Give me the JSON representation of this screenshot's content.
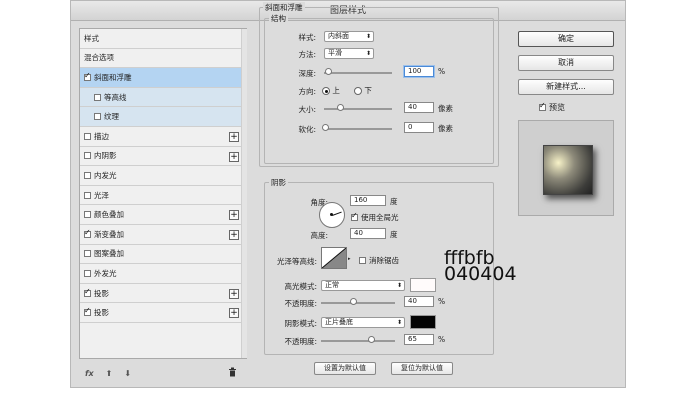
{
  "title": "图层样式",
  "sidebar": {
    "items": [
      {
        "label": "样式",
        "checkbox": false,
        "checked": false,
        "plus": false
      },
      {
        "label": "混合选项",
        "checkbox": false,
        "checked": false,
        "plus": false
      },
      {
        "label": "斜面和浮雕",
        "checkbox": true,
        "checked": true,
        "plus": false,
        "selected": true
      },
      {
        "label": "等高线",
        "checkbox": true,
        "checked": false,
        "plus": false,
        "sub": true
      },
      {
        "label": "纹理",
        "checkbox": true,
        "checked": false,
        "plus": false,
        "sub": true
      },
      {
        "label": "描边",
        "checkbox": true,
        "checked": false,
        "plus": true
      },
      {
        "label": "内阴影",
        "checkbox": true,
        "checked": false,
        "plus": true
      },
      {
        "label": "内发光",
        "checkbox": true,
        "checked": false,
        "plus": false
      },
      {
        "label": "光泽",
        "checkbox": true,
        "checked": false,
        "plus": false
      },
      {
        "label": "颜色叠加",
        "checkbox": true,
        "checked": false,
        "plus": true
      },
      {
        "label": "渐变叠加",
        "checkbox": true,
        "checked": true,
        "plus": true
      },
      {
        "label": "图案叠加",
        "checkbox": true,
        "checked": false,
        "plus": false
      },
      {
        "label": "外发光",
        "checkbox": true,
        "checked": false,
        "plus": false
      },
      {
        "label": "投影",
        "checkbox": true,
        "checked": true,
        "plus": true
      },
      {
        "label": "投影",
        "checkbox": true,
        "checked": true,
        "plus": true
      }
    ],
    "bottom": {
      "fx": "fx",
      "up": "⬆",
      "down": "⬇",
      "trash": "🗑"
    }
  },
  "bevel": {
    "section_title": "斜面和浮雕",
    "structure_title": "结构",
    "style_label": "样式:",
    "style_value": "内斜面",
    "technique_label": "方法:",
    "technique_value": "平滑",
    "depth_label": "深度:",
    "depth_value": "100",
    "depth_unit": "%",
    "direction_label": "方向:",
    "dir_up": "上",
    "dir_down": "下",
    "size_label": "大小:",
    "size_value": "40",
    "size_unit": "像素",
    "soften_label": "软化:",
    "soften_value": "0",
    "soften_unit": "像素"
  },
  "shading": {
    "title": "阴影",
    "angle_label": "角度:",
    "angle_value": "160",
    "angle_unit": "度",
    "global_light": "使用全局光",
    "altitude_label": "高度:",
    "altitude_value": "40",
    "altitude_unit": "度",
    "gloss_label": "光泽等高线:",
    "antialias": "消除锯齿",
    "highlight_mode_label": "高光模式:",
    "highlight_mode": "正常",
    "highlight_opacity_label": "不透明度:",
    "highlight_opacity": "40",
    "highlight_opacity_unit": "%",
    "shadow_mode_label": "阴影模式:",
    "shadow_mode": "正片叠底",
    "shadow_opacity_label": "不透明度:",
    "shadow_opacity": "65",
    "shadow_opacity_unit": "%",
    "highlight_color": "#fffbfb",
    "shadow_color": "#040404",
    "annotation_highlight": "fffbfb",
    "annotation_shadow": "040404"
  },
  "footer": {
    "set_default": "设置为默认值",
    "reset_default": "复位为默认值"
  },
  "actions": {
    "ok": "确定",
    "cancel": "取消",
    "new_style": "新建样式...",
    "preview": "预览"
  }
}
